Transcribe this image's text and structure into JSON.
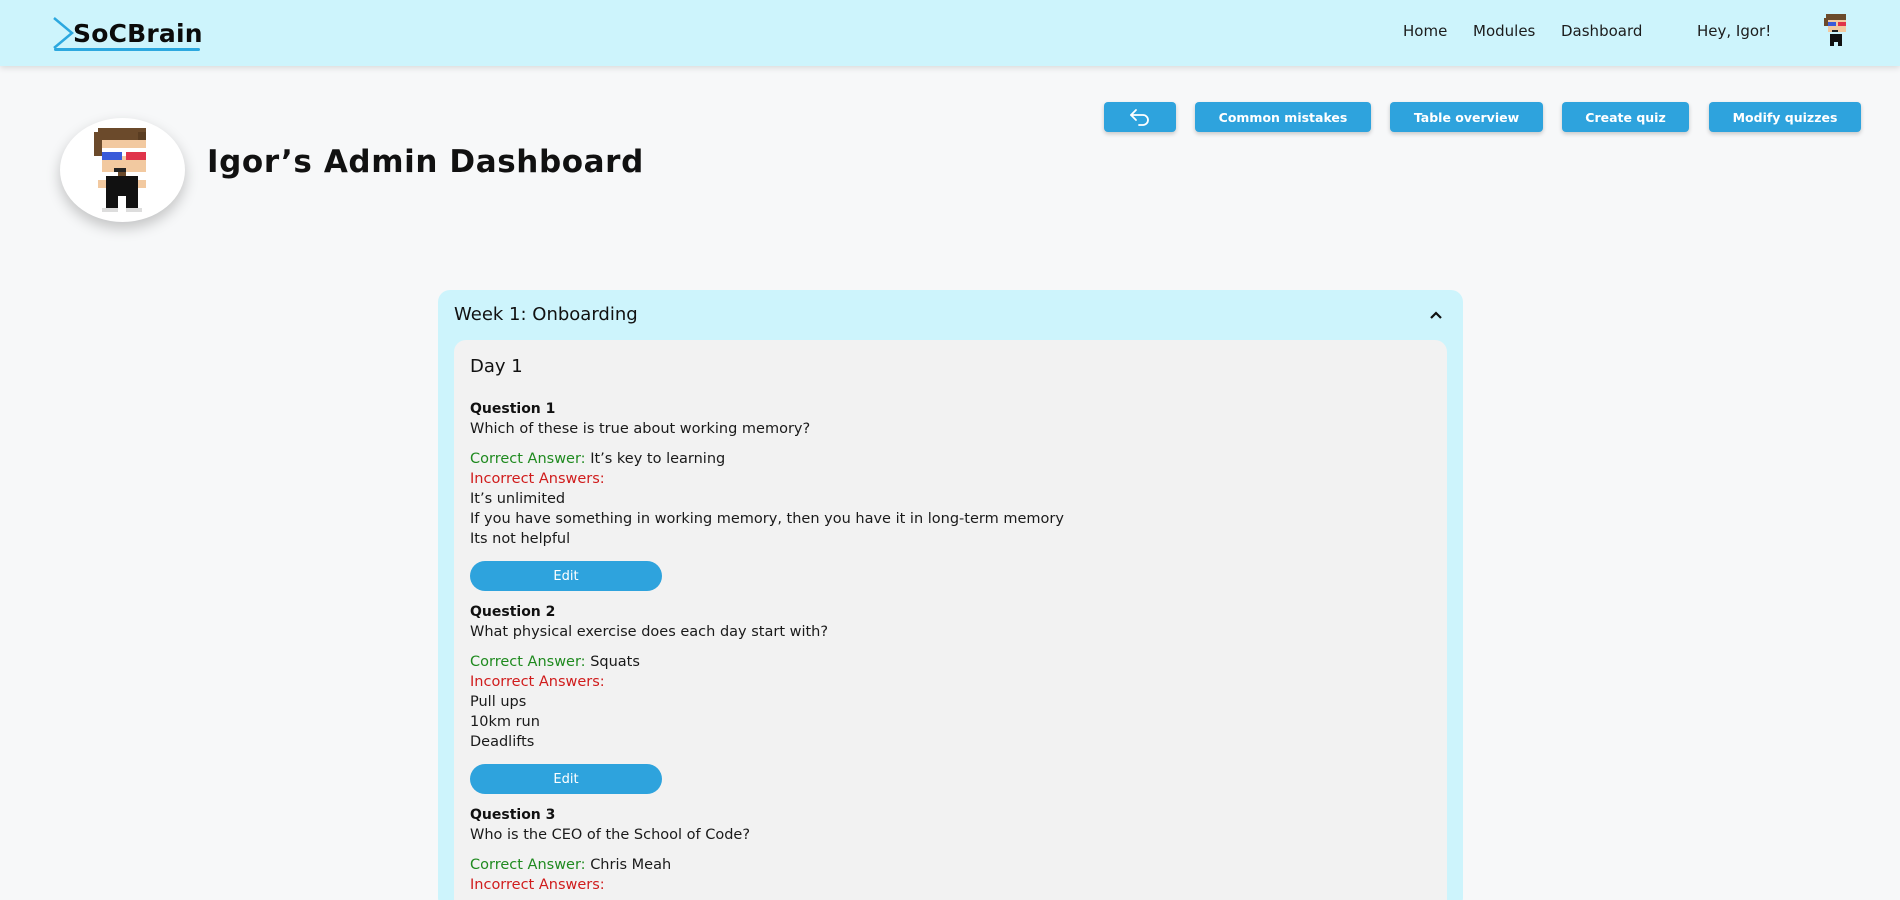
{
  "nav": {
    "brand": "SoCBrain",
    "links": [
      "Home",
      "Modules",
      "Dashboard"
    ],
    "greeting": "Hey, Igor!"
  },
  "header": {
    "title": "Igor’s Admin Dashboard"
  },
  "actions": {
    "back_icon": "undo-arrow-icon",
    "common_mistakes": "Common mistakes",
    "table_overview": "Table overview",
    "create_quiz": "Create quiz",
    "modify_quizzes": "Modify quizzes"
  },
  "week": {
    "title": "Week 1: Onboarding",
    "collapse_icon": "chevron-up-icon",
    "day": {
      "title": "Day 1",
      "correct_label": "Correct Answer:",
      "incorrect_label": "Incorrect Answers:",
      "edit_label": "Edit",
      "questions": [
        {
          "title": "Question 1",
          "text": "Which of these is true about working memory?",
          "correct": "It’s key to learning",
          "incorrect": [
            "It’s unlimited",
            "If you have something in working memory, then you have it in long-term memory",
            "Its not helpful"
          ]
        },
        {
          "title": "Question 2",
          "text": "What physical exercise does each day start with?",
          "correct": "Squats",
          "incorrect": [
            "Pull ups",
            "10km run",
            "Deadlifts"
          ]
        },
        {
          "title": "Question 3",
          "text": "Who is the CEO of the School of Code?",
          "correct": "Chris Meah",
          "incorrect": []
        }
      ]
    }
  },
  "colors": {
    "navbar_bg": "#cdf4fc",
    "button_blue": "#2ea3dd",
    "correct_green": "#1f8a1f",
    "incorrect_red": "#d01c1c"
  }
}
